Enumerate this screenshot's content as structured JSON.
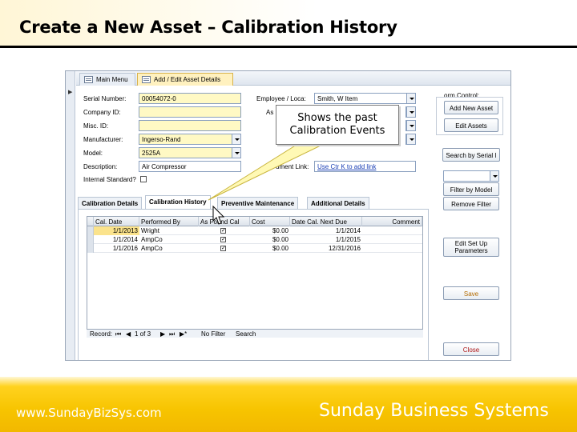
{
  "slide": {
    "title": "Create a New Asset – Calibration History",
    "footer_url": "www.SundayBizSys.com",
    "footer_brand": "Sunday Business Systems"
  },
  "app": {
    "tabs": [
      {
        "label": "Main Menu",
        "icon": "form-icon"
      },
      {
        "label": "Add / Edit Asset Details",
        "icon": "form-icon"
      }
    ],
    "fields": {
      "serial_label": "Serial Number:",
      "serial_value": "00054072-0",
      "company_label": "Company ID:",
      "company_value": "",
      "misc_label": "Misc. ID:",
      "misc_value": "",
      "manufacturer_label": "Manufacturer:",
      "manufacturer_value": "Ingerso-Rand",
      "model_label": "Model:",
      "model_value": "2525A",
      "description_label": "Description:",
      "description_value": "Air Compressor",
      "internal_label": "Internal Standard?",
      "employee_label": "Employee / Loca:",
      "employee_value": "Smith, W Item",
      "as_label": "As",
      "document_label": "ument Link:",
      "document_value": "Use Ctr K to add link"
    },
    "form_control": {
      "title": "orm Control:",
      "add_new_asset": "Add New Asset",
      "edit_assets": "Edit Assets",
      "search_label": "Search by Serial I",
      "filter_by_model": "Filter by Model",
      "remove_filter": "Remove Filter",
      "edit_setup_line1": "Edit Set Up",
      "edit_setup_line2": "Parameters",
      "save": "Save",
      "close": "Close"
    },
    "sub_tabs": [
      "Calibration Details",
      "Calibration History",
      "Preventive Maintenance",
      "Additional Details"
    ],
    "grid": {
      "columns": [
        "Cal. Date",
        "Performed By",
        "As Found Cal",
        "Cost",
        "Date Cal. Next Due",
        "Comment"
      ],
      "rows": [
        {
          "date": "1/1/2013",
          "by": "Wright",
          "as_found": true,
          "cost": "$0.00",
          "next_due": "1/1/2014",
          "comment": ""
        },
        {
          "date": "1/1/2014",
          "by": "AmpCo",
          "as_found": true,
          "cost": "$0.00",
          "next_due": "1/1/2015",
          "comment": ""
        },
        {
          "date": "1/1/2016",
          "by": "AmpCo",
          "as_found": true,
          "cost": "$0.00",
          "next_due": "12/31/2016",
          "comment": ""
        }
      ]
    },
    "record_nav": {
      "label": "Record:",
      "first": "⏮",
      "prev": "◀",
      "position": "1 of 3",
      "next": "▶",
      "last": "⏭",
      "new": "▶*",
      "filter": "No Filter",
      "search": "Search"
    }
  },
  "callout": {
    "line1": "Shows the past",
    "line2": "Calibration Events"
  }
}
